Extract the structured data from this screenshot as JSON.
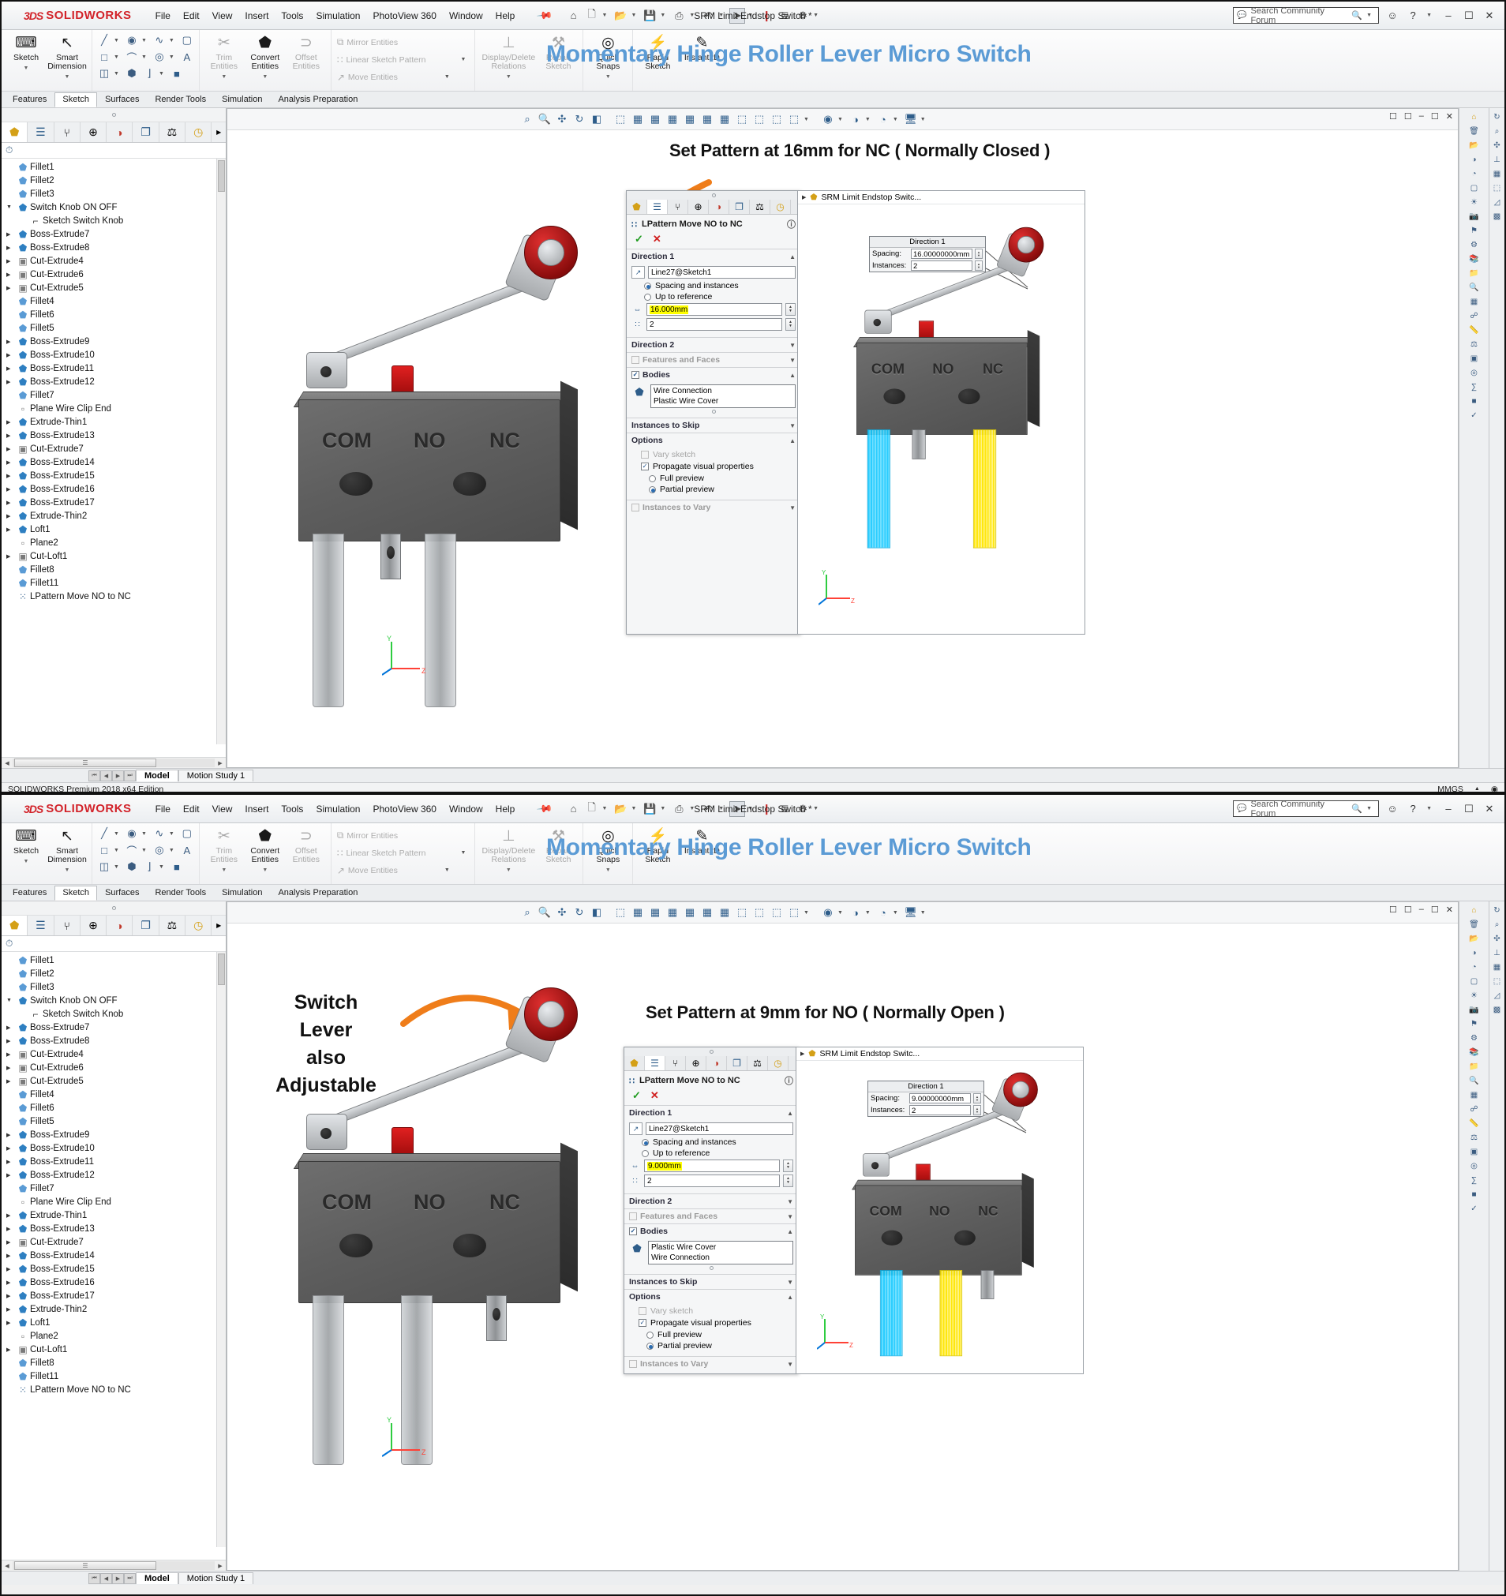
{
  "app": {
    "brand_ds": "3DS",
    "brand_name": "SOLIDWORKS",
    "doc_title": "SRM Limit Endstop Switch *",
    "status_text": "SOLIDWORKS Premium 2018 x64 Edition",
    "units": "MMGS",
    "accent_title_color": "#5b9bd5",
    "brand_red": "#d2232a"
  },
  "menu": [
    "File",
    "Edit",
    "View",
    "Insert",
    "Tools",
    "Simulation",
    "PhotoView 360",
    "Window",
    "Help"
  ],
  "quick_access": [
    {
      "name": "home-icon",
      "glyph": "⌂"
    },
    {
      "name": "new-document-icon",
      "glyph": "὜B"
    },
    {
      "name": "open-folder-icon",
      "glyph": "Ὄ2"
    },
    {
      "name": "save-icon",
      "glyph": "ὋE"
    },
    {
      "name": "print-icon",
      "glyph": "⎙"
    },
    {
      "name": "undo-icon",
      "glyph": "↶"
    },
    {
      "name": "select-cursor-icon",
      "glyph": "➤"
    },
    {
      "name": "rebuild-icon",
      "glyph": "❙"
    },
    {
      "name": "options-list-icon",
      "glyph": "≣"
    },
    {
      "name": "gear-icon",
      "glyph": "⚙"
    }
  ],
  "search": {
    "placeholder": "Search Community Forum",
    "icon": "search-icon"
  },
  "window_buttons": [
    {
      "name": "user-account-icon",
      "glyph": "☺"
    },
    {
      "name": "help-icon",
      "glyph": "?"
    },
    {
      "name": "minimize-button",
      "glyph": "–"
    },
    {
      "name": "maximize-button",
      "glyph": "☐"
    },
    {
      "name": "close-button",
      "glyph": "✕"
    }
  ],
  "ribbon": {
    "title": "Momentary Hinge Roller Lever Micro Switch",
    "big_buttons": [
      {
        "label": "Sketch",
        "icon": "sketch-icon",
        "glyph": "⌐",
        "dim": false
      },
      {
        "label": "Smart\nDimension",
        "icon": "smart-dimension-icon",
        "glyph": "↖",
        "dim": false
      },
      {
        "label": "Trim\nEntities",
        "icon": "trim-entities-icon",
        "glyph": "✂",
        "dim": true
      },
      {
        "label": "Convert\nEntities",
        "icon": "convert-entities-icon",
        "glyph": "⬟",
        "dim": false
      },
      {
        "label": "Offset\nEntities",
        "icon": "offset-entities-icon",
        "glyph": "⊃",
        "dim": true
      },
      {
        "label": "Display/Delete\nRelations",
        "icon": "display-delete-relations-icon",
        "glyph": "⊥",
        "dim": true
      },
      {
        "label": "Repair\nSketch",
        "icon": "repair-sketch-icon",
        "glyph": "⚒",
        "dim": true
      },
      {
        "label": "Quick\nSnaps",
        "icon": "quick-snaps-icon",
        "glyph": "◎",
        "dim": false
      },
      {
        "label": "Rapid\nSketch",
        "icon": "rapid-sketch-icon",
        "glyph": "⚡",
        "dim": false
      },
      {
        "label": "Instant2D",
        "icon": "instant2d-icon",
        "glyph": "✎",
        "dim": false
      }
    ],
    "text_buttons": [
      {
        "label": "Mirror Entities",
        "icon": "mirror-entities-icon",
        "glyph": "⧉"
      },
      {
        "label": "Linear Sketch Pattern",
        "icon": "linear-sketch-pattern-icon",
        "glyph": "∷"
      },
      {
        "label": "Move Entities",
        "icon": "move-entities-icon",
        "glyph": "↗"
      }
    ]
  },
  "command_tabs": [
    {
      "label": "Features",
      "active": false
    },
    {
      "label": "Sketch",
      "active": true
    },
    {
      "label": "Surfaces",
      "active": false
    },
    {
      "label": "Render Tools",
      "active": false
    },
    {
      "label": "Simulation",
      "active": false
    },
    {
      "label": "Analysis Preparation",
      "active": false
    }
  ],
  "tree_tabs": [
    {
      "name": "feature-manager-tab",
      "glyph": "⬟",
      "active": true
    },
    {
      "name": "property-manager-tab",
      "glyph": "☰",
      "active": false
    },
    {
      "name": "configuration-manager-tab",
      "glyph": "⑂",
      "active": false
    },
    {
      "name": "dimxpert-manager-tab",
      "glyph": "⊕",
      "active": false
    },
    {
      "name": "display-manager-tab",
      "glyph": "◕",
      "active": false
    },
    {
      "name": "render-manager-tab",
      "glyph": "❐",
      "active": false
    },
    {
      "name": "simulation-tab",
      "glyph": "⚒",
      "active": false
    },
    {
      "name": "appearance-tab",
      "glyph": "✇",
      "active": false
    }
  ],
  "filter_icon": "filter-icon",
  "tree_top": [
    {
      "label": "Fillet1",
      "icon": "fillet-icon",
      "arrow": "none",
      "indent": 1
    },
    {
      "label": "Fillet2",
      "icon": "fillet-icon",
      "arrow": "none",
      "indent": 1
    },
    {
      "label": "Fillet3",
      "icon": "fillet-icon",
      "arrow": "none",
      "indent": 1
    },
    {
      "label": "Switch Knob ON OFF",
      "icon": "boss-extrude-icon",
      "arrow": "open",
      "indent": 1
    },
    {
      "label": "Sketch Switch Knob",
      "icon": "sketch-icon",
      "arrow": "none",
      "indent": 2
    },
    {
      "label": "Boss-Extrude7",
      "icon": "boss-extrude-icon",
      "arrow": "closed",
      "indent": 1
    },
    {
      "label": "Boss-Extrude8",
      "icon": "boss-extrude-icon",
      "arrow": "closed",
      "indent": 1
    },
    {
      "label": "Cut-Extrude4",
      "icon": "cut-extrude-icon",
      "arrow": "closed",
      "indent": 1
    },
    {
      "label": "Cut-Extrude6",
      "icon": "cut-extrude-icon",
      "arrow": "closed",
      "indent": 1
    },
    {
      "label": "Cut-Extrude5",
      "icon": "cut-extrude-icon",
      "arrow": "closed",
      "indent": 1
    },
    {
      "label": "Fillet4",
      "icon": "fillet-icon",
      "arrow": "none",
      "indent": 1
    },
    {
      "label": "Fillet6",
      "icon": "fillet-icon",
      "arrow": "none",
      "indent": 1
    },
    {
      "label": "Fillet5",
      "icon": "fillet-icon",
      "arrow": "none",
      "indent": 1
    },
    {
      "label": "Boss-Extrude9",
      "icon": "boss-extrude-icon",
      "arrow": "closed",
      "indent": 1
    },
    {
      "label": "Boss-Extrude10",
      "icon": "boss-extrude-icon",
      "arrow": "closed",
      "indent": 1
    },
    {
      "label": "Boss-Extrude11",
      "icon": "boss-extrude-icon",
      "arrow": "closed",
      "indent": 1
    },
    {
      "label": "Boss-Extrude12",
      "icon": "boss-extrude-icon",
      "arrow": "closed",
      "indent": 1
    },
    {
      "label": "Fillet7",
      "icon": "fillet-icon",
      "arrow": "none",
      "indent": 1
    },
    {
      "label": "Plane Wire Clip End",
      "icon": "plane-icon",
      "arrow": "none",
      "indent": 1
    },
    {
      "label": "Extrude-Thin1",
      "icon": "boss-extrude-icon",
      "arrow": "closed",
      "indent": 1
    },
    {
      "label": "Boss-Extrude13",
      "icon": "boss-extrude-icon",
      "arrow": "closed",
      "indent": 1
    },
    {
      "label": "Cut-Extrude7",
      "icon": "cut-extrude-icon",
      "arrow": "closed",
      "indent": 1
    },
    {
      "label": "Boss-Extrude14",
      "icon": "boss-extrude-icon",
      "arrow": "closed",
      "indent": 1
    },
    {
      "label": "Boss-Extrude15",
      "icon": "boss-extrude-icon",
      "arrow": "closed",
      "indent": 1
    },
    {
      "label": "Boss-Extrude16",
      "icon": "boss-extrude-icon",
      "arrow": "closed",
      "indent": 1
    },
    {
      "label": "Boss-Extrude17",
      "icon": "boss-extrude-icon",
      "arrow": "closed",
      "indent": 1
    },
    {
      "label": "Extrude-Thin2",
      "icon": "boss-extrude-icon",
      "arrow": "closed",
      "indent": 1
    },
    {
      "label": "Loft1",
      "icon": "loft-icon",
      "arrow": "closed",
      "indent": 1
    },
    {
      "label": "Plane2",
      "icon": "plane-icon",
      "arrow": "none",
      "indent": 1
    },
    {
      "label": "Cut-Loft1",
      "icon": "cut-loft-icon",
      "arrow": "closed",
      "indent": 1
    },
    {
      "label": "Fillet8",
      "icon": "fillet-icon",
      "arrow": "none",
      "indent": 1
    },
    {
      "label": "Fillet11",
      "icon": "fillet-icon",
      "arrow": "none",
      "indent": 1
    },
    {
      "label": "LPattern Move NO to NC",
      "icon": "lpattern-icon",
      "arrow": "none",
      "indent": 1
    }
  ],
  "tree_bottom": [
    {
      "label": "Fillet1",
      "icon": "fillet-icon",
      "arrow": "none",
      "indent": 1
    },
    {
      "label": "Fillet2",
      "icon": "fillet-icon",
      "arrow": "none",
      "indent": 1
    },
    {
      "label": "Fillet3",
      "icon": "fillet-icon",
      "arrow": "none",
      "indent": 1
    },
    {
      "label": "Switch Knob ON OFF",
      "icon": "boss-extrude-icon",
      "arrow": "open",
      "indent": 1
    },
    {
      "label": "Sketch Switch Knob",
      "icon": "sketch-icon",
      "arrow": "none",
      "indent": 2
    },
    {
      "label": "Boss-Extrude7",
      "icon": "boss-extrude-icon",
      "arrow": "closed",
      "indent": 1
    },
    {
      "label": "Boss-Extrude8",
      "icon": "boss-extrude-icon",
      "arrow": "closed",
      "indent": 1
    },
    {
      "label": "Cut-Extrude4",
      "icon": "cut-extrude-icon",
      "arrow": "closed",
      "indent": 1
    },
    {
      "label": "Cut-Extrude6",
      "icon": "cut-extrude-icon",
      "arrow": "closed",
      "indent": 1
    },
    {
      "label": "Cut-Extrude5",
      "icon": "cut-extrude-icon",
      "arrow": "closed",
      "indent": 1
    },
    {
      "label": "Fillet4",
      "icon": "fillet-icon",
      "arrow": "none",
      "indent": 1
    },
    {
      "label": "Fillet6",
      "icon": "fillet-icon",
      "arrow": "none",
      "indent": 1
    },
    {
      "label": "Fillet5",
      "icon": "fillet-icon",
      "arrow": "none",
      "indent": 1
    },
    {
      "label": "Boss-Extrude9",
      "icon": "boss-extrude-icon",
      "arrow": "closed",
      "indent": 1
    },
    {
      "label": "Boss-Extrude10",
      "icon": "boss-extrude-icon",
      "arrow": "closed",
      "indent": 1
    },
    {
      "label": "Boss-Extrude11",
      "icon": "boss-extrude-icon",
      "arrow": "closed",
      "indent": 1
    },
    {
      "label": "Boss-Extrude12",
      "icon": "boss-extrude-icon",
      "arrow": "closed",
      "indent": 1
    },
    {
      "label": "Fillet7",
      "icon": "fillet-icon",
      "arrow": "none",
      "indent": 1
    },
    {
      "label": "Plane Wire Clip End",
      "icon": "plane-icon",
      "arrow": "none",
      "indent": 1
    },
    {
      "label": "Extrude-Thin1",
      "icon": "boss-extrude-icon",
      "arrow": "closed",
      "indent": 1
    },
    {
      "label": "Boss-Extrude13",
      "icon": "boss-extrude-icon",
      "arrow": "closed",
      "indent": 1
    },
    {
      "label": "Cut-Extrude7",
      "icon": "cut-extrude-icon",
      "arrow": "closed",
      "indent": 1
    },
    {
      "label": "Boss-Extrude14",
      "icon": "boss-extrude-icon",
      "arrow": "closed",
      "indent": 1
    },
    {
      "label": "Boss-Extrude15",
      "icon": "boss-extrude-icon",
      "arrow": "closed",
      "indent": 1
    },
    {
      "label": "Boss-Extrude16",
      "icon": "boss-extrude-icon",
      "arrow": "closed",
      "indent": 1
    },
    {
      "label": "Boss-Extrude17",
      "icon": "boss-extrude-icon",
      "arrow": "closed",
      "indent": 1
    },
    {
      "label": "Extrude-Thin2",
      "icon": "boss-extrude-icon",
      "arrow": "closed",
      "indent": 1
    },
    {
      "label": "Loft1",
      "icon": "loft-icon",
      "arrow": "closed",
      "indent": 1
    },
    {
      "label": "Plane2",
      "icon": "plane-icon",
      "arrow": "none",
      "indent": 1
    },
    {
      "label": "Cut-Loft1",
      "icon": "cut-loft-icon",
      "arrow": "closed",
      "indent": 1
    },
    {
      "label": "Fillet8",
      "icon": "fillet-icon",
      "arrow": "none",
      "indent": 1
    },
    {
      "label": "Fillet11",
      "icon": "fillet-icon",
      "arrow": "none",
      "indent": 1
    },
    {
      "label": "LPattern Move NO to NC",
      "icon": "lpattern-icon",
      "arrow": "none",
      "indent": 1
    }
  ],
  "model_tabs": [
    {
      "label": "Model",
      "active": true
    },
    {
      "label": "Motion Study 1",
      "active": false
    }
  ],
  "switch_labels": [
    "COM",
    "NO",
    "NC"
  ],
  "annotations": {
    "top_heading": "Set Pattern at 16mm for NC ( Normally Closed )",
    "bottom_heading": "Set Pattern at 9mm for NO ( Normally Open )",
    "lever_note": "Switch\nLever\nalso\nAdjustable",
    "arrow_color": "#ef7d1a"
  },
  "property_manager_top": {
    "feature_name": "LPattern Move NO to NC",
    "feature_icon": "lpattern-icon",
    "help_icon": "help-icon",
    "ok_glyph": "✓",
    "cancel_glyph": "✕",
    "sections": {
      "direction1": {
        "title": "Direction 1",
        "reference": "Line27@Sketch1",
        "reference_icon": "direction-arrow-icon",
        "radio_spacing": "Spacing and instances",
        "radio_uptoref": "Up to reference",
        "spacing_value": "16.000mm",
        "instances_value": "2",
        "spacing_icon": "spacing-icon",
        "instances_icon": "instances-icon"
      },
      "direction2": {
        "title": "Direction 2"
      },
      "features_and_faces": {
        "title": "Features and Faces"
      },
      "bodies": {
        "title": "Bodies",
        "items": [
          "Wire Connection",
          "Plastic Wire Cover"
        ],
        "icon": "solid-body-icon"
      },
      "instances_to_skip": {
        "title": "Instances to Skip"
      },
      "options": {
        "title": "Options",
        "vary_sketch": "Vary sketch",
        "propagate": "Propagate visual properties",
        "full_preview": "Full preview",
        "partial_preview": "Partial preview"
      },
      "instances_to_vary": {
        "title": "Instances to Vary"
      }
    }
  },
  "property_manager_bottom": {
    "feature_name": "LPattern Move NO to NC",
    "feature_icon": "lpattern-icon",
    "help_icon": "help-icon",
    "ok_glyph": "✓",
    "cancel_glyph": "✕",
    "sections": {
      "direction1": {
        "title": "Direction 1",
        "reference": "Line27@Sketch1",
        "reference_icon": "direction-arrow-icon",
        "radio_spacing": "Spacing and instances",
        "radio_uptoref": "Up to reference",
        "spacing_value": "9.000mm",
        "instances_value": "2",
        "spacing_icon": "spacing-icon",
        "instances_icon": "instances-icon"
      },
      "direction2": {
        "title": "Direction 2"
      },
      "features_and_faces": {
        "title": "Features and Faces"
      },
      "bodies": {
        "title": "Bodies",
        "items": [
          "Plastic Wire Cover",
          "Wire Connection"
        ],
        "icon": "solid-body-icon"
      },
      "instances_to_skip": {
        "title": "Instances to Skip"
      },
      "options": {
        "title": "Options",
        "vary_sketch": "Vary sketch",
        "propagate": "Propagate visual properties",
        "full_preview": "Full preview",
        "partial_preview": "Partial preview"
      },
      "instances_to_vary": {
        "title": "Instances to Vary"
      }
    }
  },
  "preview_top": {
    "tree_root": "SRM Limit Endstop Switc...",
    "callout": {
      "title": "Direction 1",
      "spacing_label": "Spacing:",
      "spacing_value": "16.00000000mm",
      "instances_label": "Instances:",
      "instances_value": "2"
    }
  },
  "preview_bottom": {
    "tree_root": "SRM Limit Endstop Switc...",
    "callout": {
      "title": "Direction 1",
      "spacing_label": "Spacing:",
      "spacing_value": "9.00000000mm",
      "instances_label": "Instances:",
      "instances_value": "2"
    }
  },
  "view_toolbar": [
    {
      "name": "zoom-to-fit-icon",
      "glyph": "⌕"
    },
    {
      "name": "zoom-to-area-icon",
      "glyph": "⌕"
    },
    {
      "name": "pan-icon",
      "glyph": "✛"
    },
    {
      "name": "rotate-view-icon",
      "glyph": "↻"
    },
    {
      "name": "section-view-icon",
      "glyph": "◧"
    },
    {
      "name": "view-orientation-icon",
      "glyph": "⬜"
    },
    {
      "name": "front-view-icon",
      "glyph": "⬛"
    },
    {
      "name": "back-view-icon",
      "glyph": "⬛"
    },
    {
      "name": "left-view-icon",
      "glyph": "⬛"
    },
    {
      "name": "right-view-icon",
      "glyph": "⬛"
    },
    {
      "name": "top-view-icon",
      "glyph": "⬛"
    },
    {
      "name": "bottom-view-icon",
      "glyph": "⬛"
    },
    {
      "name": "iso-view-icon",
      "glyph": "⬛"
    },
    {
      "name": "trimetric-view-icon",
      "glyph": "⬛"
    },
    {
      "name": "dimetric-view-icon",
      "glyph": "⬛"
    },
    {
      "name": "display-style-icon",
      "glyph": "⬛"
    },
    {
      "name": "hide-show-items-icon",
      "glyph": "◉"
    },
    {
      "name": "edit-appearance-icon",
      "glyph": "◕"
    },
    {
      "name": "apply-scene-icon",
      "glyph": "◔"
    },
    {
      "name": "view-settings-icon",
      "glyph": "Ὓ5"
    }
  ]
}
